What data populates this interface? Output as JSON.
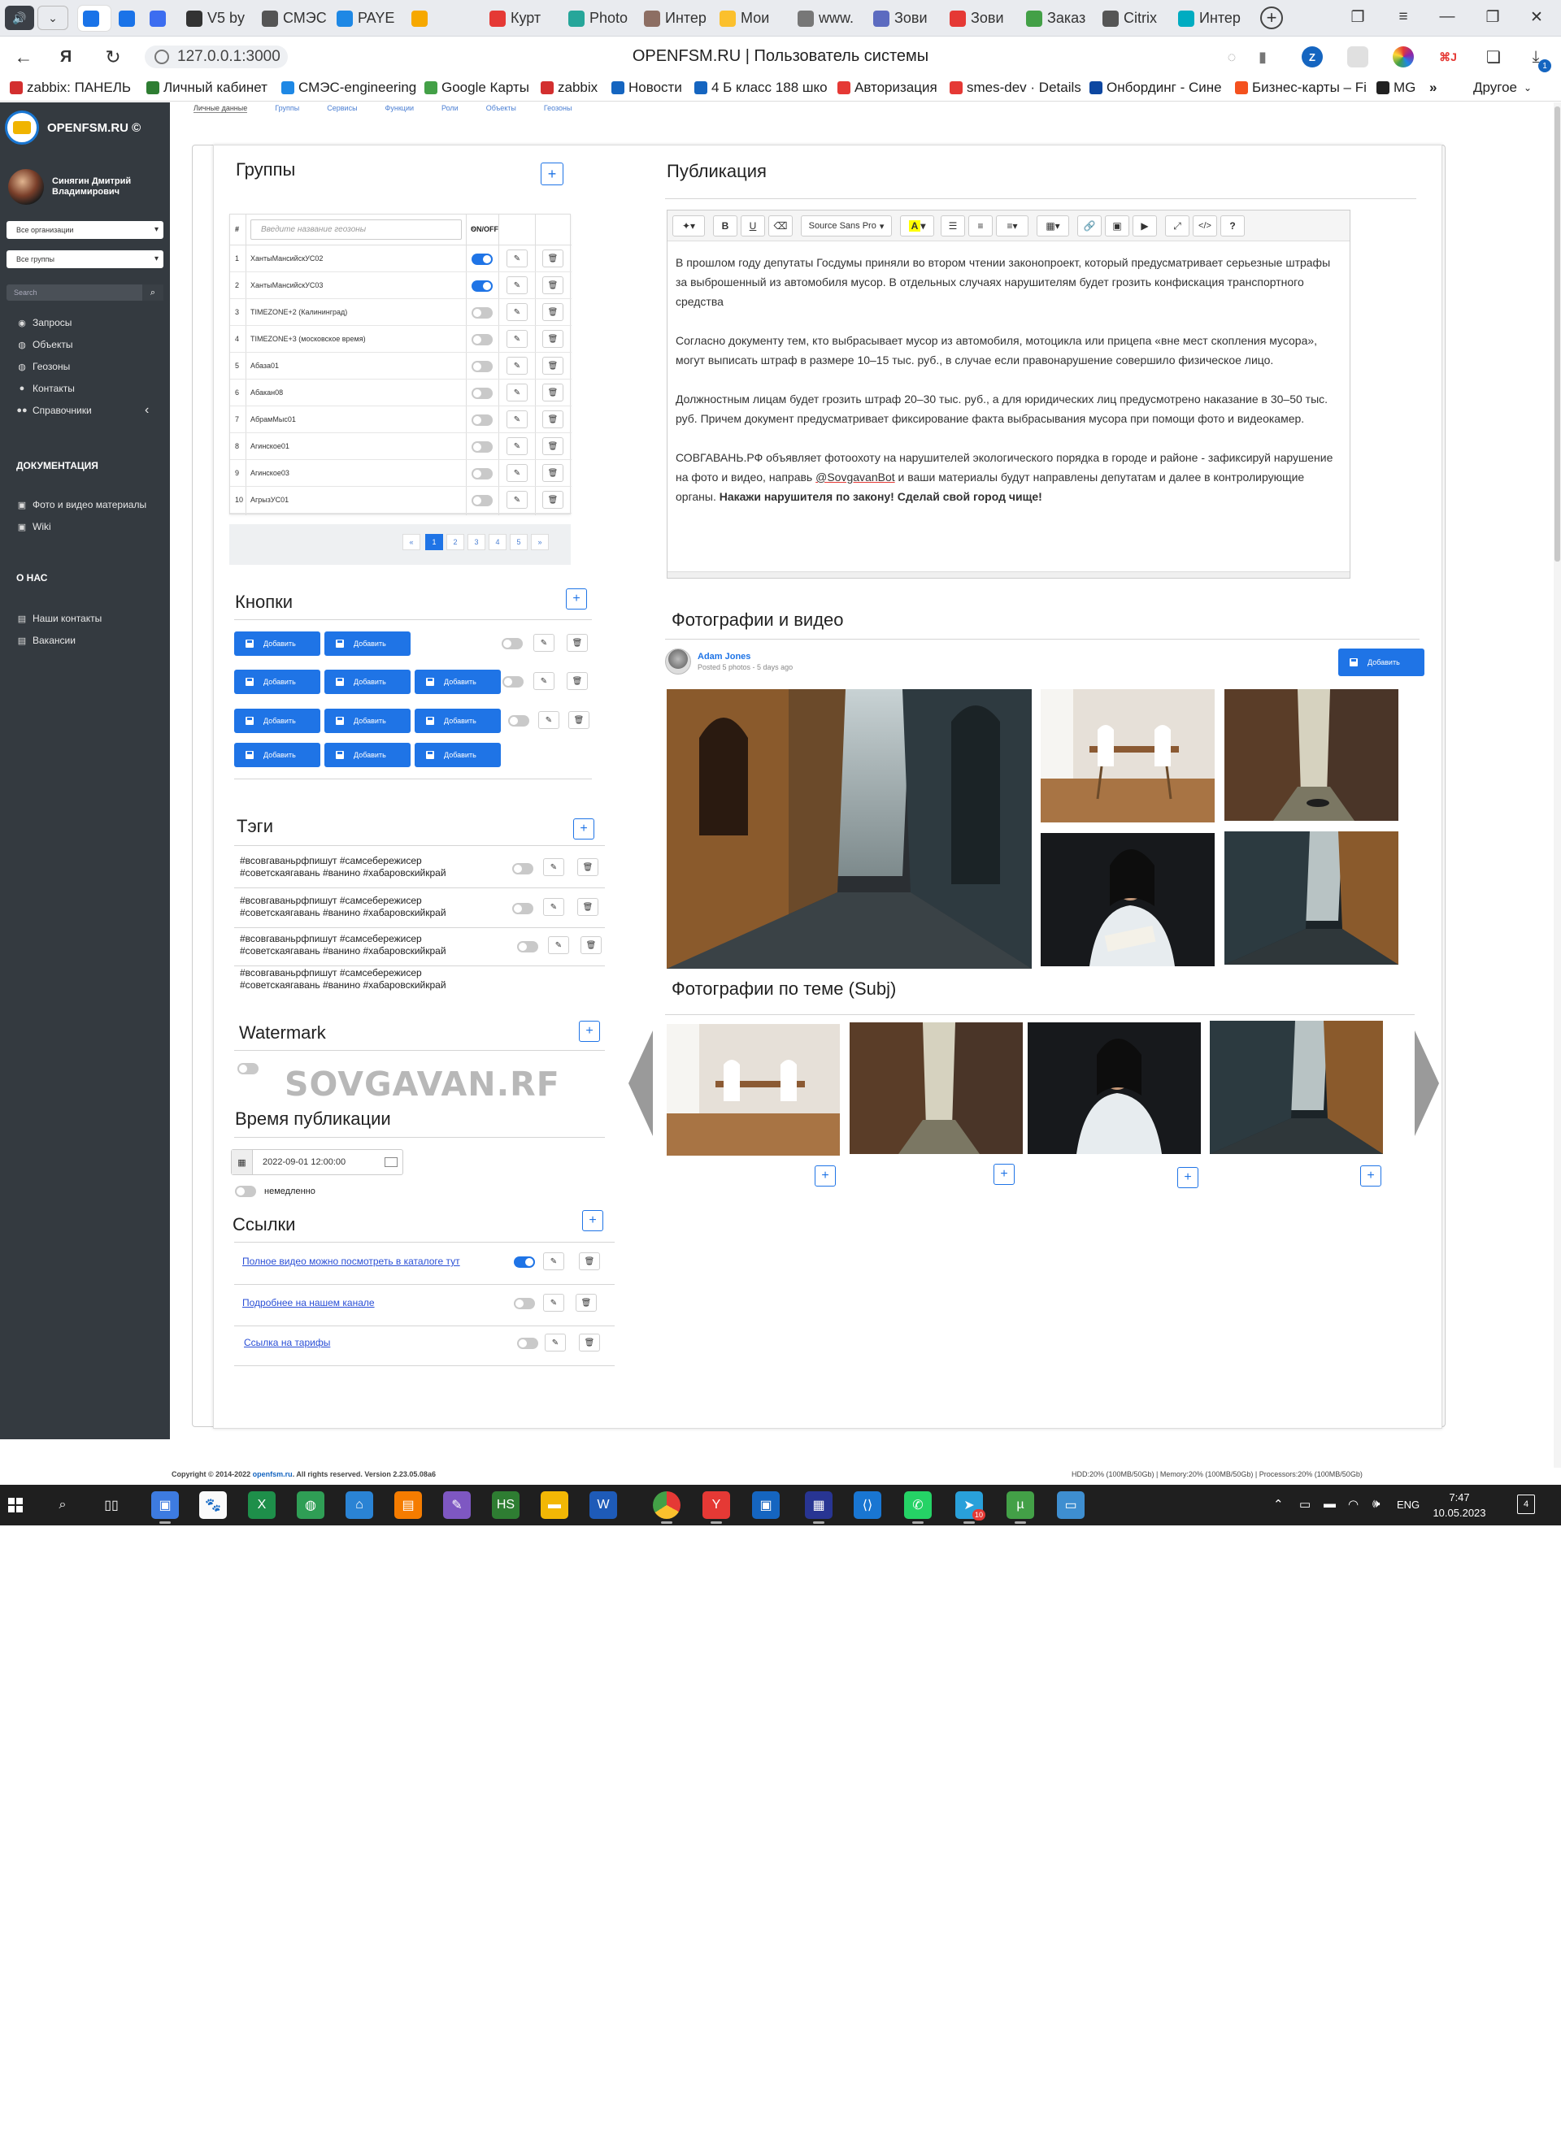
{
  "browser": {
    "tabs": [
      {
        "label": "",
        "active": true,
        "color": "#1a73e8"
      },
      {
        "label": "",
        "color": "#1a73e8"
      },
      {
        "label": "",
        "color": "#3c6df0"
      },
      {
        "label": "V5 by",
        "color": "#333333"
      },
      {
        "label": "СМЭС",
        "color": "#555555"
      },
      {
        "label": "PAYE",
        "color": "#1e88e5"
      },
      {
        "label": "",
        "color": "#f6a800"
      },
      {
        "label": "Курт",
        "color": "#e53935"
      },
      {
        "label": "Photo",
        "color": "#26a69a"
      },
      {
        "label": "Интер",
        "color": "#8d6e63"
      },
      {
        "label": "Мои",
        "color": "#fbc02d"
      },
      {
        "label": "www.",
        "color": "#777777"
      },
      {
        "label": "Зови",
        "color": "#5c6bc0"
      },
      {
        "label": "Зови",
        "color": "#e53935"
      },
      {
        "label": "Заказ",
        "color": "#43a047"
      },
      {
        "label": "Citrix",
        "color": "#555555"
      },
      {
        "label": "Интер",
        "color": "#00acc1"
      }
    ],
    "url": "127.0.0.1:3000",
    "title": "OPENFSM.RU | Пользователь системы",
    "ext_badge": "1",
    "bookmarks": [
      {
        "label": "zabbix: ПАНЕЛЬ",
        "color": "#d32f2f"
      },
      {
        "label": "Личный кабинет",
        "color": "#2e7d32"
      },
      {
        "label": "СМЭС-engineering",
        "color": "#1e88e5"
      },
      {
        "label": "Google Карты",
        "color": "#43a047"
      },
      {
        "label": "zabbix",
        "color": "#d32f2f"
      },
      {
        "label": "Новости",
        "color": "#1565c0"
      },
      {
        "label": "4 Б класс 188 шко",
        "color": "#1565c0"
      },
      {
        "label": "Авторизация",
        "color": "#e53935"
      },
      {
        "label": "smes-dev · Details",
        "color": "#e53935"
      },
      {
        "label": "Онбординг - Сине",
        "color": "#0d47a1"
      },
      {
        "label": "Бизнес-карты – Fi",
        "color": "#f4511e"
      },
      {
        "label": "MG",
        "color": "#212121"
      }
    ],
    "bookmarks_more": "»",
    "bookmarks_other": "Другое"
  },
  "sidebar": {
    "brand": "OPENFSM.RU ©",
    "user_name_line1": "Синягин Дмитрий",
    "user_name_line2": "Владимирович",
    "org_select": "Все организации",
    "group_select": "Все группы",
    "search_placeholder": "Search",
    "menu": [
      {
        "label": "Запросы",
        "icon": "dashboard-icon"
      },
      {
        "label": "Объекты",
        "icon": "globe-icon"
      },
      {
        "label": "Геозоны",
        "icon": "globe-icon"
      },
      {
        "label": "Контакты",
        "icon": "user-icon"
      },
      {
        "label": "Справочники",
        "icon": "users-icon"
      }
    ],
    "doc_heading": "ДОКУМЕНТАЦИЯ",
    "doc_items": [
      "Фото и видео материалы",
      "Wiki"
    ],
    "about_heading": "О НАС",
    "about_items": [
      "Наши контакты",
      "Вакансии"
    ]
  },
  "page_tabs": [
    "Личные данные",
    "Группы",
    "Сервисы",
    "Функции",
    "Роли",
    "Объекты",
    "Геозоны"
  ],
  "groups": {
    "title": "Группы",
    "col_num": "#",
    "search_placeholder": "Введите название геозоны",
    "clear": "×",
    "col_onoff": "ON/OFF",
    "rows": [
      {
        "n": "1",
        "name": "ХантыМансийскУС02",
        "on": true
      },
      {
        "n": "2",
        "name": "ХантыМансийскУС03",
        "on": true
      },
      {
        "n": "3",
        "name": "TIMEZONE+2 (Калининград)",
        "on": false
      },
      {
        "n": "4",
        "name": "TIMEZONE+3 (московское время)",
        "on": false
      },
      {
        "n": "5",
        "name": "Абаза01",
        "on": false
      },
      {
        "n": "6",
        "name": "Абакан08",
        "on": false
      },
      {
        "n": "7",
        "name": "АбрамМыс01",
        "on": false
      },
      {
        "n": "8",
        "name": "Агинское01",
        "on": false
      },
      {
        "n": "9",
        "name": "Агинское03",
        "on": false
      },
      {
        "n": "10",
        "name": "АгрызУС01",
        "on": false
      }
    ],
    "pager": [
      "«",
      "1",
      "2",
      "3",
      "4",
      "5",
      "»"
    ]
  },
  "buttons": {
    "title": "Кнопки",
    "add_label": "Добавить"
  },
  "tags": {
    "title": "Тэги",
    "rows": [
      {
        "line1": "#всовгаваньрфпишут #самсебережисер",
        "line2": "#советскаягавань #ванино #хабаровскийкрай"
      },
      {
        "line1": "#всовгаваньрфпишут #самсебережисер",
        "line2": "#советскаягавань #ванино #хабаровскийкрай"
      },
      {
        "line1": "#всовгаваньрфпишут #самсебережисер",
        "line2": "#советскаягавань #ванино #хабаровскийкрай"
      },
      {
        "line1": "#всовгаваньрфпишут #самсебережисер",
        "line2": "#советскаягавань #ванино #хабаровскийкрай"
      }
    ]
  },
  "watermark": {
    "title": "Watermark",
    "text": "SOVGAVAN.RF"
  },
  "publish_time": {
    "title": "Время публикации",
    "value": "2022-09-01 12:00:00",
    "immediate": "немедленно"
  },
  "links": {
    "title": "Ссылки",
    "rows": [
      {
        "text": "Полное видео можно посмотреть в каталоге тут",
        "on": true
      },
      {
        "text": "Подробнее на нашем канале",
        "on": false
      },
      {
        "text": "Ссылка на тарифы",
        "on": false
      }
    ]
  },
  "publication": {
    "title": "Публикация",
    "font_select": "Source Sans Pro",
    "paragraphs": [
      "В прошлом году депутаты Госдумы приняли во втором чтении законопроект, который предусматривает серьезные штрафы за выброшенный из автомобиля мусор. В отдельных случаях нарушителям будет грозить конфискация транспортного средства",
      "Согласно документу тем, кто выбрасывает мусор из автомобиля, мотоцикла или прицепа «вне мест скопления мусора», могут выписать штраф в размере 10–15 тыс. руб., в случае если правонарушение совершило физическое лицо.",
      "Должностным лицам будет грозить штраф 20–30 тыс. руб., а для юридических лиц предусмотрено наказание в 30–50 тыс. руб. Причем документ предусматривает фиксирование факта выбрасывания мусора при помощи фото и видеокамер."
    ],
    "p4_start": "СОВГАВАНЬ.РФ объявляет фотоохоту  на нарушителей экологического порядка в городе и районе - зафиксируй нарушение на фото и видео, направь ",
    "p4_mention": "@SovgavanBot",
    "p4_mid": " и ваши материалы будут направлены депутатам и далее в контролирующие органы. ",
    "p4_bold": "Накажи нарушителя по закону! Сделай свой город чище!"
  },
  "media": {
    "title": "Фотографии и видео",
    "author": "Adam Jones",
    "meta": "Posted 5 photos - 5 days ago",
    "add_label": "Добавить"
  },
  "subj": {
    "title": "Фотографии по теме (Subj)"
  },
  "footer": {
    "copyright": "Copyright © 2014-2022 ",
    "site": "openfsm.ru",
    "rest": ".  All rights reserved.  Version 2.23.05.08a6",
    "stats": "HDD:20% (100MB/50Gb) | Memory:20% (100MB/50Gb) | Processors:20% (100MB/50Gb)"
  },
  "taskbar": {
    "lang": "ENG",
    "time": "7:47",
    "date": "10.05.2023",
    "notif": "4",
    "telegram_badge": "10"
  }
}
